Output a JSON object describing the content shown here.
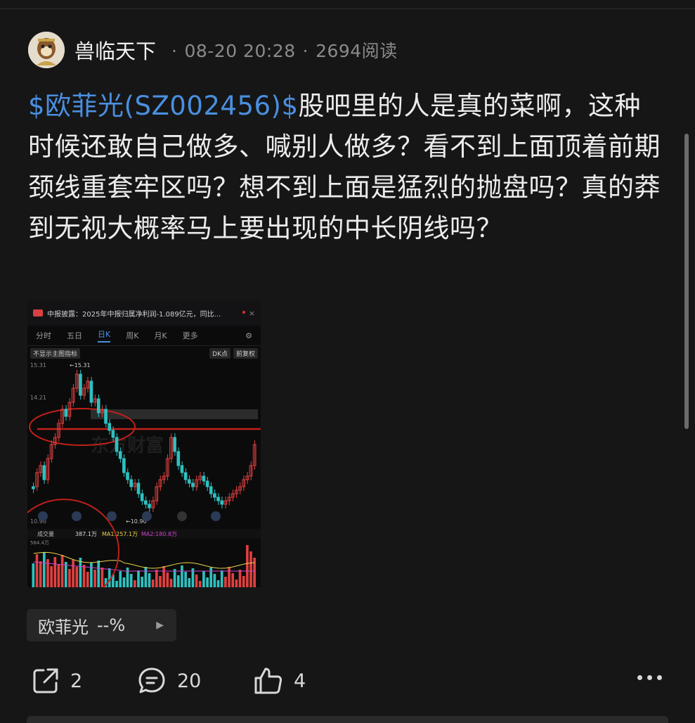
{
  "post": {
    "author": "兽临天下",
    "date": "08-20 20:28",
    "reads": "2694阅读",
    "stock_link": "$欧菲光(SZ002456)$",
    "body": "股吧里的人是真的菜啊，这种时候还敢自己做多、喊别人做多？看不到上面顶着前期颈线重套牢区吗？想不到上面是猛烈的抛盘吗？真的莽到无视大概率马上要出现的中长阴线吗？"
  },
  "chart_image": {
    "notice": "中报披露：2025年中报归属净利润-1.089亿元，同比...",
    "tabs": [
      "分时",
      "五日",
      "日K",
      "周K",
      "月K",
      "更多"
    ],
    "active_tab": "日K",
    "indicator_toggle": "不显示主图指标",
    "dk_label": "DK点",
    "adjust_label": "前复权",
    "price_high": "15.31",
    "price_high_marker": "←15.31",
    "price_mid": "14.21",
    "price_low": "10.90",
    "price_low_marker": "←10.90",
    "volume_label": "成交量",
    "volume_value": "387.1万",
    "ma1": "MA1:257.1万",
    "ma2": "MA2:180.8万",
    "volume_axis": "564.4万",
    "watermark": "东方财富",
    "colors": {
      "up": "#e04040",
      "down": "#2fc0c0",
      "ma1": "#e8d24a",
      "ma2": "#d040d0",
      "circle": "#c0201a"
    }
  },
  "stock_chip": {
    "name": "欧菲光",
    "change": "--%"
  },
  "actions": {
    "share_count": "2",
    "comment_count": "20",
    "like_count": "4"
  },
  "icons": [
    "share-icon",
    "comment-icon",
    "like-icon",
    "more-icon"
  ]
}
